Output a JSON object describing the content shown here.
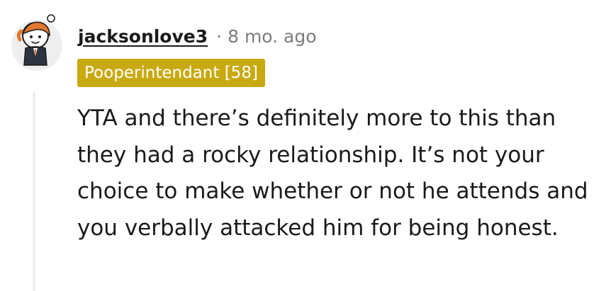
{
  "comment": {
    "author": "jacksonlove3",
    "separator": "·",
    "timestamp": "8 mo. ago",
    "flair": "Pooperintendant [58]",
    "body": "YTA and there’s definitely more to this than they had a rocky relationship. It’s not your choice to make whether or not he attends and you verbally attacked him for being honest.",
    "avatar_icon": "snoo-avatar-icon"
  },
  "colors": {
    "flair_background": "#c8a90f",
    "flair_text": "#ffffff",
    "meta_text": "#7c7c7c",
    "thread_line": "#edeff1",
    "body_text": "#1a1a1b"
  }
}
